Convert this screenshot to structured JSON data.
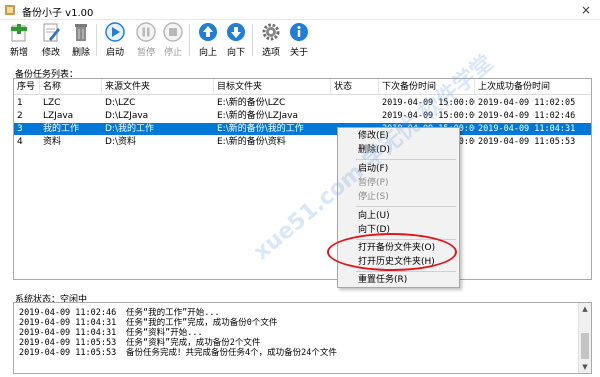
{
  "window": {
    "title": "备份小子 v1.00",
    "close_glyph": "×"
  },
  "toolbar": {
    "new": "新增",
    "edit": "修改",
    "delete": "删除",
    "start": "启动",
    "pause": "暂停",
    "stop": "停止",
    "up": "向上",
    "down": "向下",
    "options": "选项",
    "about": "关于"
  },
  "list_caption": "备份任务列表：",
  "table": {
    "headers": [
      "序号",
      "名称",
      "来源文件夹",
      "目标文件夹",
      "状态",
      "下次备份时间",
      "上次成功备份时间"
    ],
    "rows": [
      [
        "1",
        "LZC",
        "D:\\LZC",
        "E:\\新的备份\\LZC",
        "",
        "2019-04-09 15:00:00",
        "2019-04-09 11:02:05"
      ],
      [
        "2",
        "LZJava",
        "D:\\LZJava",
        "E:\\新的备份\\LZJava",
        "",
        "2019-04-09 15:00:00",
        "2019-04-09 11:02:46"
      ],
      [
        "3",
        "我的工作",
        "D:\\我的工作",
        "E:\\新的备份\\我的工作",
        "",
        "2019-04-09 15:00:00",
        "2019-04-09 11:04:31"
      ],
      [
        "4",
        "资料",
        "D:\\资料",
        "E:\\新的备份\\资料",
        "",
        "2019-04-09 15:00:00",
        "2019-04-09 11:05:53"
      ]
    ],
    "selected_row": 2
  },
  "context_menu": {
    "items": [
      {
        "label": "修改(E)",
        "enabled": true
      },
      {
        "label": "删除(D)",
        "enabled": true
      },
      {
        "label": "启动(F)",
        "enabled": true
      },
      {
        "label": "暂停(P)",
        "enabled": false
      },
      {
        "label": "停止(S)",
        "enabled": false
      },
      {
        "label": "向上(U)",
        "enabled": true
      },
      {
        "label": "向下(D)",
        "enabled": true
      },
      {
        "label": "打开备份文件夹(O)",
        "enabled": true
      },
      {
        "label": "打开历史文件夹(H)",
        "enabled": true
      },
      {
        "label": "重置任务(R)",
        "enabled": true
      }
    ]
  },
  "status": {
    "label": "系统状态：空闲中",
    "log": [
      {
        "time": "2019-04-09 11:02:46",
        "msg": "任务“我的工作”开始..."
      },
      {
        "time": "2019-04-09 11:04:31",
        "msg": "任务“我的工作”完成，成功备份0个文件"
      },
      {
        "time": "2019-04-09 11:04:31",
        "msg": "任务“资料”开始..."
      },
      {
        "time": "2019-04-09 11:05:53",
        "msg": "任务“资料”完成，成功备份2个文件"
      },
      {
        "time": "2019-04-09 11:05:53",
        "msg": "备份任务完成！共完成备份任务4个，成功备份24个文件"
      }
    ]
  },
  "watermark": "xue51.com 学无忧 软件学堂",
  "colors": {
    "selection": "#0078d7",
    "highlight_ellipse": "#e3141b",
    "icon_blue": "#1f7fd8",
    "icon_green": "#2e9b2e",
    "disabled": "#9a9a9a"
  }
}
